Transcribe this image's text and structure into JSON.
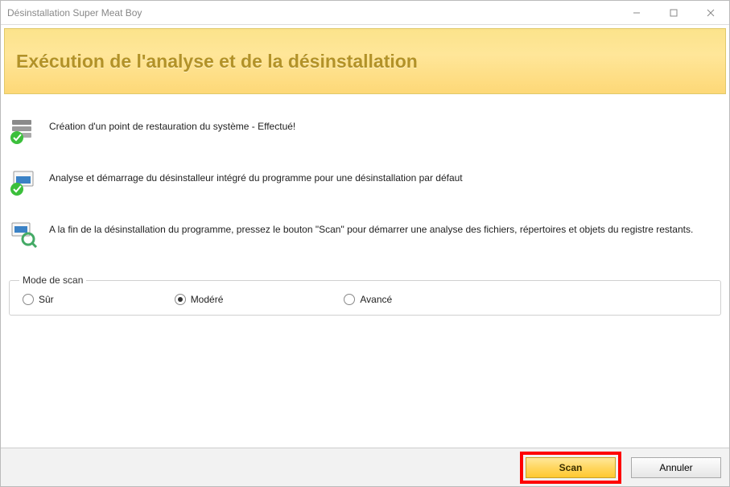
{
  "window": {
    "title": "Désinstallation Super Meat Boy"
  },
  "header": {
    "heading": "Exécution de l'analyse et de la désinstallation"
  },
  "steps": {
    "restore_point": "Création d'un point de restauration du système - Effectué!",
    "uninstaller": "Analyse et démarrage du désinstalleur intégré du programme pour une désinstallation par défaut",
    "scan_prompt": "A la fin de la désinstallation du programme, pressez le bouton \"Scan\" pour démarrer une analyse des fichiers, répertoires et objets du registre restants."
  },
  "scan_mode": {
    "legend": "Mode de scan",
    "options": {
      "safe": "Sûr",
      "moderate": "Modéré",
      "advanced": "Avancé"
    },
    "selected": "moderate"
  },
  "buttons": {
    "scan": "Scan",
    "cancel": "Annuler"
  }
}
